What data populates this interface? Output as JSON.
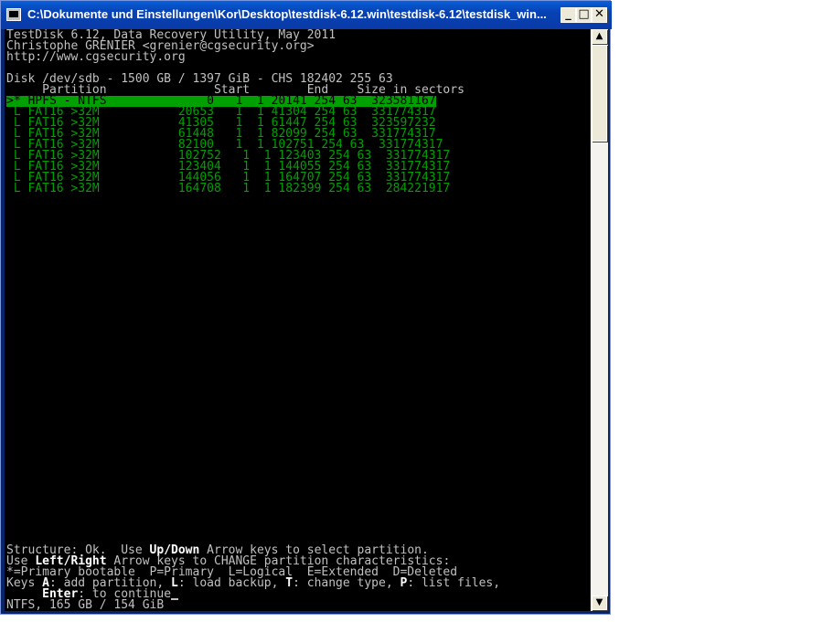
{
  "window": {
    "title": "C:\\Dokumente und Einstellungen\\Kor\\Desktop\\testdisk-6.12.win\\testdisk-6.12\\testdisk_win...",
    "minimize": "_",
    "maximize": "□",
    "close": "✕"
  },
  "console": {
    "header": [
      "TestDisk 6.12, Data Recovery Utility, May 2011",
      "Christophe GRENIER <grenier@cgsecurity.org>",
      "http://www.cgsecurity.org"
    ],
    "disk_line": "Disk /dev/sdb - 1500 GB / 1397 GiB - CHS 182402 255 63",
    "columns_line": "     Partition               Start        End    Size in sectors",
    "partitions": [
      ">* HPFS - NTFS              0   1  1 20141 254 63  323581167",
      " L FAT16 >32M           20653   1  1 41304 254 63  331774317",
      " L FAT16 >32M           41305   1  1 61447 254 63  323597232",
      " L FAT16 >32M           61448   1  1 82099 254 63  331774317",
      " L FAT16 >32M           82100   1  1 102751 254 63  331774317",
      " L FAT16 >32M           102752   1  1 123403 254 63  331774317",
      " L FAT16 >32M           123404   1  1 144055 254 63  331774317",
      " L FAT16 >32M           144056   1  1 164707 254 63  331774317",
      " L FAT16 >32M           164708   1  1 182399 254 63  284221917"
    ],
    "footer": {
      "l1a": "Structure: Ok.  Use ",
      "l1b": "Up/Down",
      "l1c": " Arrow keys to select partition.",
      "l2a": "Use ",
      "l2b": "Left/Right",
      "l2c": " Arrow keys to CHANGE partition characteristics:",
      "l3": "*=Primary bootable  P=Primary  L=Logical  E=Extended  D=Deleted",
      "l4a": "Keys ",
      "l4b": "A",
      "l4c": ": add partition, ",
      "l4d": "L",
      "l4e": ": load backup, ",
      "l4f": "T",
      "l4g": ": change type, ",
      "l4h": "P",
      "l4i": ": list files,",
      "l5a": "     ",
      "l5b": "Enter",
      "l5c": ": to continue",
      "l6": "NTFS, 165 GB / 154 GiB"
    }
  },
  "scrollbar": {
    "up": "▲",
    "down": "▼"
  }
}
